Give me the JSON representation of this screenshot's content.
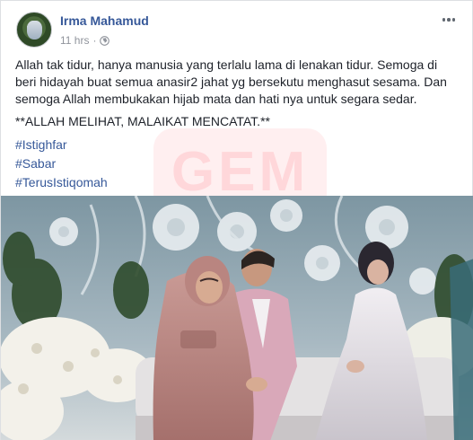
{
  "post": {
    "author": "Irma Mahamud",
    "time": "11 hrs",
    "paragraph1": "Allah tak tidur, hanya manusia yang terlalu lama di lenakan tidur. Semoga di beri hidayah buat semua anasir2 jahat yg bersekutu menghasut sesama. Dan semoga Allah membukakan hijab mata dan hati nya untuk segara sedar.",
    "paragraph2": "**ALLAH MELIHAT, MALAIKAT MENCATAT.**",
    "hashtags": [
      "#Istighfar",
      "#Sabar",
      "#TerusIstiqomah"
    ]
  },
  "watermark": "GEM",
  "icons": {
    "privacy": "globe-icon",
    "menu": "more-options-icon"
  },
  "colors": {
    "link": "#365899",
    "meta": "#90949c",
    "text": "#1d2129"
  }
}
